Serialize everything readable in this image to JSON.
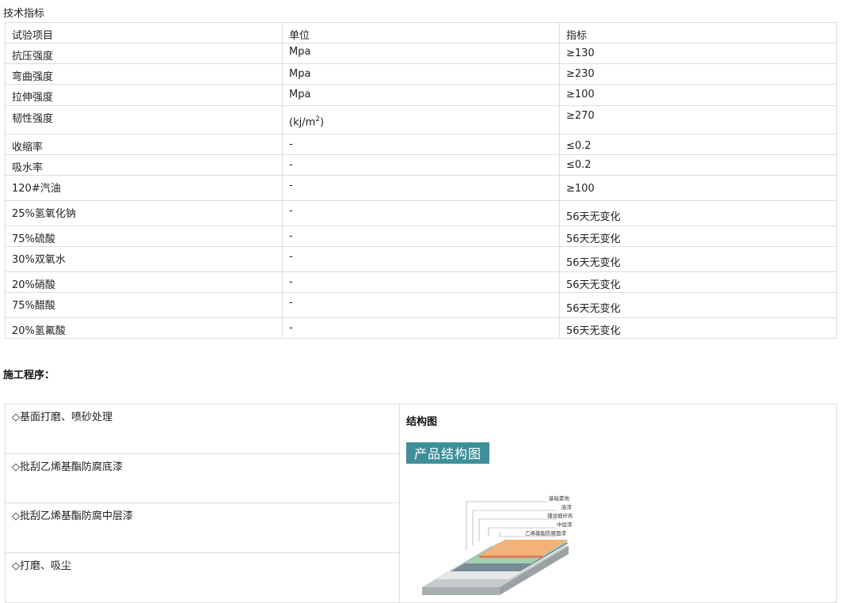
{
  "spec": {
    "title": "技术指标",
    "headers": [
      "试验项目",
      "单位",
      "指标"
    ],
    "rows": [
      {
        "item": "抗压强度",
        "unit": "Mpa",
        "value": "≥130"
      },
      {
        "item": "弯曲强度",
        "unit": "Mpa",
        "value": "≥230"
      },
      {
        "item": "拉伸强度",
        "unit": "Mpa",
        "value": "≥100"
      },
      {
        "item": "韧性强度",
        "unit": "(kj/m",
        "unit_sup": "2",
        "unit_suffix": ")",
        "value": "≥270"
      },
      {
        "item": "收缩率",
        "unit": "-",
        "value": "≤0.2"
      },
      {
        "item": "吸水率",
        "unit": "-",
        "value": "≤0.2"
      },
      {
        "item": "120#汽油",
        "unit": "-",
        "value": "≥100"
      },
      {
        "item": "25%氢氧化钠",
        "unit": "-",
        "value": "56天无变化"
      },
      {
        "item": "75%硫酸",
        "unit": "-",
        "value": "56天无变化"
      },
      {
        "item": "30%双氧水",
        "unit": "-",
        "value": "56天无变化"
      },
      {
        "item": "20%硝酸",
        "unit": "-",
        "value": "56天无变化"
      },
      {
        "item": "75%醋酸",
        "unit": "-",
        "value": "56天无变化"
      },
      {
        "item": "20%氢氟酸",
        "unit": "-",
        "value": "56天无变化"
      }
    ]
  },
  "procedure": {
    "title": "施工程序：",
    "steps": [
      "◇基面打磨、喷砂处理",
      "◇批刮乙烯基酯防腐底漆",
      "◇批刮乙烯基酯防腐中层漆",
      "◇打磨、吸尘"
    ],
    "structure_title": "结构图",
    "banner": "产品结构图",
    "layers": [
      "基础素地",
      "底漆",
      "铺设玻纤布",
      "中层漆",
      "乙烯基酯防腐面漆"
    ],
    "colors": {
      "banner": "#3f8f9a",
      "topcoat": "#f2b27a",
      "topcoat_edge": "#e07a5a",
      "midcoat": "#9fd3b0",
      "fiber": "#7a8a96",
      "primer": "#e7e7e7",
      "base": "#b9c0c2"
    }
  }
}
